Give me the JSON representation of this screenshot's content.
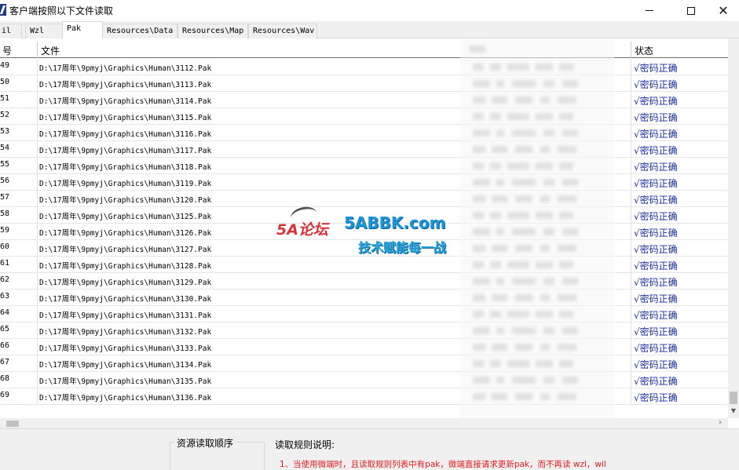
{
  "window": {
    "title": "客户端按照以下文件读取"
  },
  "tabs": [
    "il",
    "Wzl",
    "Pak",
    "Resources\\Data",
    "Resources\\Map",
    "Resources\\Wav"
  ],
  "active_tab": "Pak",
  "grid": {
    "columns": {
      "num": "号",
      "file": "文件",
      "status": "状态"
    },
    "rows": [
      {
        "num": "49",
        "file": "D:\\17周年\\9pmyj\\Graphics\\Human\\3112.Pak",
        "status": "√密码正确"
      },
      {
        "num": "50",
        "file": "D:\\17周年\\9pmyj\\Graphics\\Human\\3113.Pak",
        "status": "√密码正确"
      },
      {
        "num": "51",
        "file": "D:\\17周年\\9pmyj\\Graphics\\Human\\3114.Pak",
        "status": "√密码正确"
      },
      {
        "num": "52",
        "file": "D:\\17周年\\9pmyj\\Graphics\\Human\\3115.Pak",
        "status": "√密码正确"
      },
      {
        "num": "53",
        "file": "D:\\17周年\\9pmyj\\Graphics\\Human\\3116.Pak",
        "status": "√密码正确"
      },
      {
        "num": "54",
        "file": "D:\\17周年\\9pmyj\\Graphics\\Human\\3117.Pak",
        "status": "√密码正确"
      },
      {
        "num": "55",
        "file": "D:\\17周年\\9pmyj\\Graphics\\Human\\3118.Pak",
        "status": "√密码正确"
      },
      {
        "num": "56",
        "file": "D:\\17周年\\9pmyj\\Graphics\\Human\\3119.Pak",
        "status": "√密码正确"
      },
      {
        "num": "57",
        "file": "D:\\17周年\\9pmyj\\Graphics\\Human\\3120.Pak",
        "status": "√密码正确"
      },
      {
        "num": "58",
        "file": "D:\\17周年\\9pmyj\\Graphics\\Human\\3125.Pak",
        "status": "√密码正确"
      },
      {
        "num": "59",
        "file": "D:\\17周年\\9pmyj\\Graphics\\Human\\3126.Pak",
        "status": "√密码正确"
      },
      {
        "num": "60",
        "file": "D:\\17周年\\9pmyj\\Graphics\\Human\\3127.Pak",
        "status": "√密码正确"
      },
      {
        "num": "61",
        "file": "D:\\17周年\\9pmyj\\Graphics\\Human\\3128.Pak",
        "status": "√密码正确"
      },
      {
        "num": "62",
        "file": "D:\\17周年\\9pmyj\\Graphics\\Human\\3129.Pak",
        "status": "√密码正确"
      },
      {
        "num": "63",
        "file": "D:\\17周年\\9pmyj\\Graphics\\Human\\3130.Pak",
        "status": "√密码正确"
      },
      {
        "num": "64",
        "file": "D:\\17周年\\9pmyj\\Graphics\\Human\\3131.Pak",
        "status": "√密码正确"
      },
      {
        "num": "65",
        "file": "D:\\17周年\\9pmyj\\Graphics\\Human\\3132.Pak",
        "status": "√密码正确"
      },
      {
        "num": "66",
        "file": "D:\\17周年\\9pmyj\\Graphics\\Human\\3133.Pak",
        "status": "√密码正确"
      },
      {
        "num": "67",
        "file": "D:\\17周年\\9pmyj\\Graphics\\Human\\3134.Pak",
        "status": "√密码正确"
      },
      {
        "num": "68",
        "file": "D:\\17周年\\9pmyj\\Graphics\\Human\\3135.Pak",
        "status": "√密码正确"
      },
      {
        "num": "69",
        "file": "D:\\17周年\\9pmyj\\Graphics\\Human\\3136.Pak",
        "status": "√密码正确"
      }
    ]
  },
  "watermark": {
    "logo": "5A论坛",
    "site": "5ABBK.com",
    "slogan": "技术赋能每一战"
  },
  "bottom": {
    "resource_order_label": "资源读取顺序",
    "rules_label": "读取规则说明:",
    "rule_1": "1、当使用微端时，且读取规则列表中有pak，微端直接请求更新pak，而不再读 wzl，wil"
  },
  "colors": {
    "status": "#1a2fa6",
    "rule_text": "#e21c1c",
    "watermark_blue": "#1d94d6",
    "watermark_red": "#d9343a"
  }
}
